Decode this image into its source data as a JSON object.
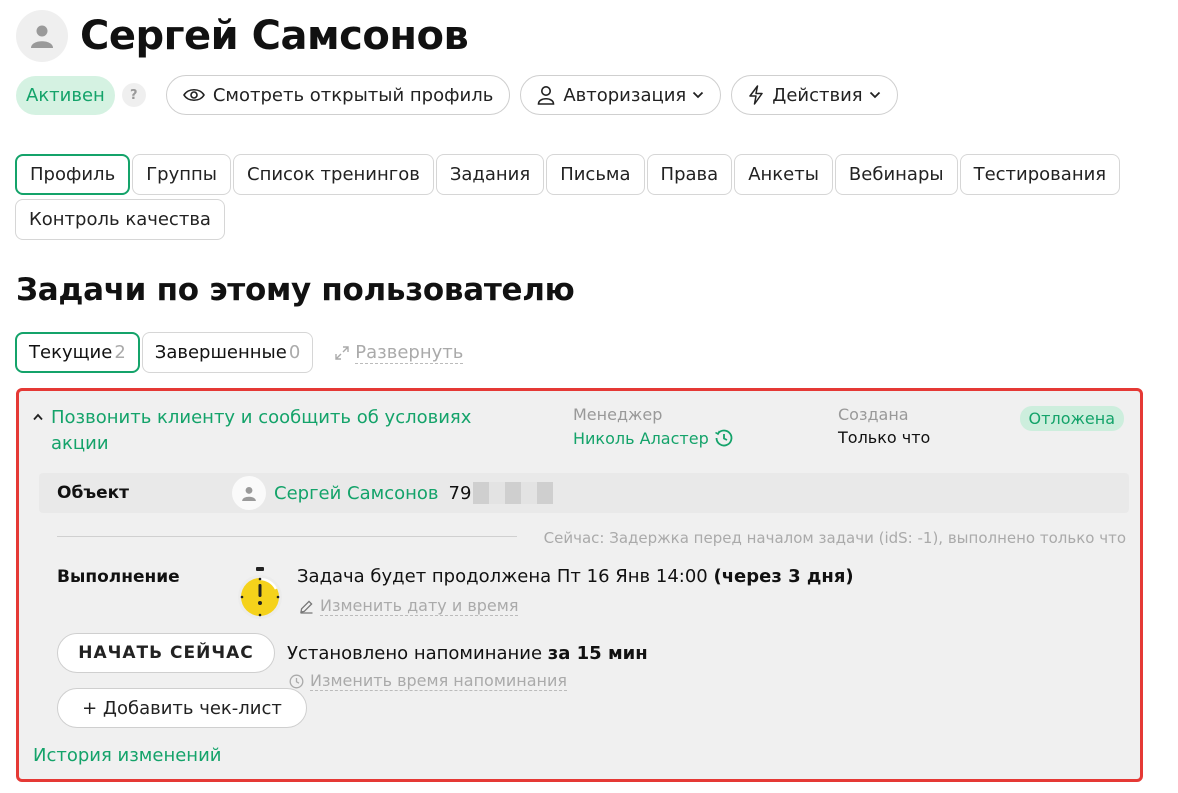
{
  "user": {
    "name": "Сергей Самсонов"
  },
  "status_row": {
    "status_label": "Активен",
    "help_label": "?",
    "view_profile_label": "Смотреть открытый профиль",
    "auth_label": "Авторизация",
    "actions_label": "Действия"
  },
  "tabs": [
    {
      "label": "Профиль",
      "active": true
    },
    {
      "label": "Группы"
    },
    {
      "label": "Список тренингов"
    },
    {
      "label": "Задания"
    },
    {
      "label": "Письма"
    },
    {
      "label": "Права"
    },
    {
      "label": "Анкеты"
    },
    {
      "label": "Вебинары"
    },
    {
      "label": "Тестирования"
    },
    {
      "label": "Контроль качества"
    }
  ],
  "tasks_section": {
    "title": "Задачи по этому пользователю",
    "subtabs": [
      {
        "label": "Текущие",
        "count": "2",
        "active": true
      },
      {
        "label": "Завершенные",
        "count": "0"
      }
    ],
    "expand_label": "Развернуть"
  },
  "task": {
    "title": "Позвонить клиенту и сообщить об условиях акции",
    "manager_label": "Менеджер",
    "manager_name": "Николь Аластер",
    "created_label": "Создана",
    "created_value": "Только что",
    "status": "Отложена",
    "object_label": "Объект",
    "object_name": "Сергей Самсонов",
    "object_phone_visible": "79",
    "now_text": "Сейчас: Задержка перед началом задачи (idS: -1), выполнено только что",
    "execution_label": "Выполнение",
    "execution_text": "Задача будет продолжена Пт 16 Янв 14:00 ",
    "execution_bold": "(через 3 дня)",
    "edit_date_label": "Изменить дату и время",
    "start_now_label": "НАЧАТЬ СЕЙЧАС",
    "reminder_text": "Установлено напоминание ",
    "reminder_bold": "за 15 мин",
    "edit_reminder_label": "Изменить время напоминания",
    "add_checklist_label": "+ Добавить чек-лист",
    "history_label": "История изменений"
  },
  "colors": {
    "accent_green": "#14a36a",
    "highlight_red": "#e53935",
    "timer_yellow": "#f5d21b"
  }
}
